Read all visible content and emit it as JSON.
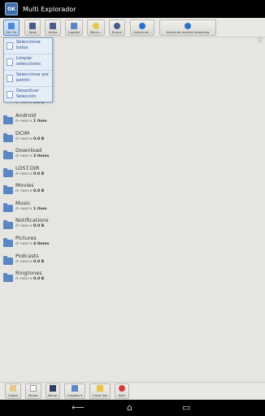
{
  "app": {
    "title": "Multi Explorador",
    "icon_text": "OK"
  },
  "toolbar": [
    {
      "label": "Sel. On",
      "icon": "select-icon",
      "color": "#4c88d8",
      "active": true
    },
    {
      "label": "Atras",
      "icon": "back-icon",
      "color": "#4a5a8c"
    },
    {
      "label": "Arriba",
      "icon": "up-icon",
      "color": "#4a5a8c"
    },
    {
      "label": "Lugares",
      "icon": "places-icon",
      "color": "#5a87c2"
    },
    {
      "label": "Marca...",
      "icon": "bookmark-icon",
      "color": "#e8c547"
    },
    {
      "label": "Buscar",
      "icon": "search-icon",
      "color": "#4a5a8c"
    },
    {
      "label": "Acerca de...",
      "icon": "info-icon",
      "color": "#2d6fcf"
    },
    {
      "label": "Acerca de servidor streaming",
      "icon": "info-icon",
      "color": "#2d6fcf"
    }
  ],
  "menu": [
    {
      "label": "Seleccionar todos"
    },
    {
      "label": "Limpiar selecciones"
    },
    {
      "label": "Seleccionar por patrón"
    },
    {
      "label": "Desactivar Selección"
    }
  ],
  "folders": [
    {
      "name": "Android",
      "perm": "d--rwxr-x",
      "size": "1 item"
    },
    {
      "name": "DCIM",
      "perm": "d--rwxr-x",
      "size": "0.0 B"
    },
    {
      "name": "Download",
      "perm": "d--rwxr-x",
      "size": "3 items"
    },
    {
      "name": "LOST.DIR",
      "perm": "d--rwxr-x",
      "size": "0.0 B"
    },
    {
      "name": "Movies",
      "perm": "d--rwxr-x",
      "size": "0.0 B"
    },
    {
      "name": "Music",
      "perm": "d--rwxr-x",
      "size": "1 item"
    },
    {
      "name": "Notifications",
      "perm": "d--rwxr-x",
      "size": "0.0 B"
    },
    {
      "name": "Pictures",
      "perm": "d--rwxr-x",
      "size": "4 items"
    },
    {
      "name": "Podcasts",
      "perm": "d--rwxr-x",
      "size": "0.0 B"
    },
    {
      "name": "Ringtones",
      "perm": "d--rwxr-x",
      "size": "0.0 B"
    }
  ],
  "partial_rows": [
    {
      "perm": "d--rwxr-x",
      "size": "0.0 B"
    }
  ],
  "bottom": [
    {
      "label": "Copiar",
      "icon": "copy-icon",
      "color": "#e3c98a"
    },
    {
      "label": "Mover",
      "icon": "move-icon",
      "color": "#ffffff"
    },
    {
      "label": "Borrar",
      "icon": "delete-icon",
      "color": "#2c3e66"
    },
    {
      "label": "Carpeta ▾",
      "icon": "folder-icon",
      "color": "#5a87c2"
    },
    {
      "label": "Crear Zip",
      "icon": "zip-icon",
      "color": "#e8c547"
    },
    {
      "label": "Salir",
      "icon": "exit-icon",
      "color": "#d33b3b"
    }
  ],
  "nav": {
    "back": "⟵",
    "home": "⌂",
    "recents": "▭"
  }
}
